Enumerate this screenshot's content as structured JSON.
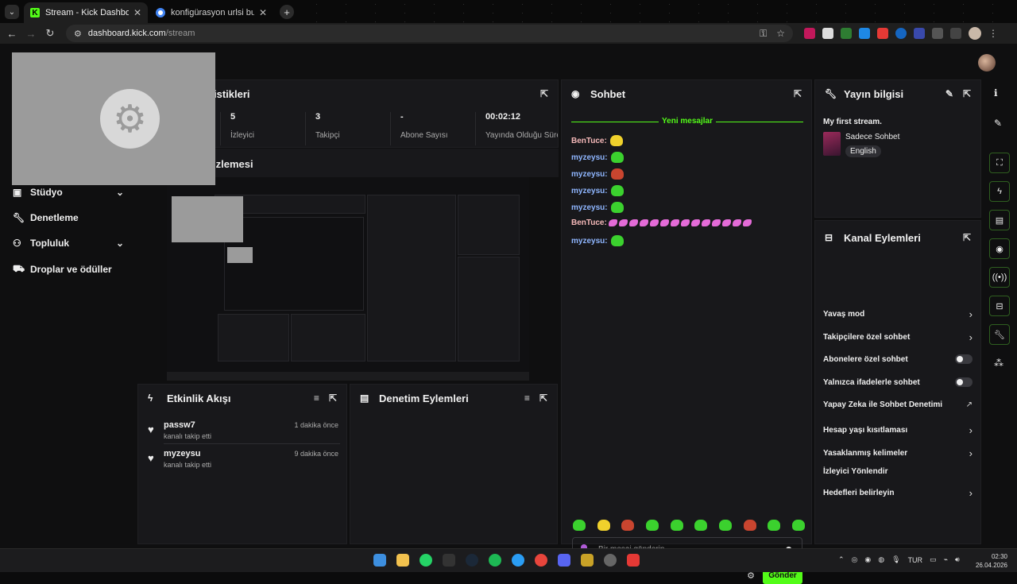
{
  "browser": {
    "tabs": [
      {
        "title": "Stream - Kick Dashboard",
        "active": true
      },
      {
        "title": "konfigürasyon urlsi bulunamadı",
        "active": false
      }
    ],
    "url_host": "dashboard.kick.com",
    "url_path": "/stream"
  },
  "sidebar": {
    "items": [
      {
        "label": "Stüdyo",
        "icon": "studio-icon",
        "chevron": true
      },
      {
        "label": "Denetleme",
        "icon": "wrench-icon",
        "chevron": false
      },
      {
        "label": "Topluluk",
        "icon": "community-icon",
        "chevron": true
      },
      {
        "label": "Droplar ve ödüller",
        "icon": "gift-icon",
        "chevron": false
      }
    ]
  },
  "stats": {
    "title_visible": "istikleri",
    "items": [
      {
        "value": "5",
        "label": "İzleyici"
      },
      {
        "value": "3",
        "label": "Takipçi"
      },
      {
        "value": "-",
        "label": "Abone Sayısı"
      },
      {
        "value": "00:02:12",
        "label": "Yayında Olduğu Süre"
      }
    ]
  },
  "preview": {
    "title_visible": "izlemesi"
  },
  "activity": {
    "title": "Etkinlik Akışı",
    "events": [
      {
        "user": "passw7",
        "action": "kanalı takip etti",
        "time": "1 dakika önce"
      },
      {
        "user": "myzeysu",
        "action": "kanalı takip etti",
        "time": "9 dakika önce"
      }
    ]
  },
  "moderation": {
    "title": "Denetim Eylemleri"
  },
  "chat": {
    "title": "Sohbet",
    "new_messages": "Yeni mesajlar",
    "messages": [
      {
        "user": "BenTuce:",
        "color": "#f4b8b8",
        "emotes": [
          "yellow"
        ]
      },
      {
        "user": "myzeysu:",
        "color": "#8fb6ff",
        "emotes": [
          "green"
        ]
      },
      {
        "user": "myzeysu:",
        "color": "#8fb6ff",
        "emotes": [
          "red"
        ]
      },
      {
        "user": "myzeysu:",
        "color": "#8fb6ff",
        "emotes": [
          "green"
        ]
      },
      {
        "user": "myzeysu:",
        "color": "#8fb6ff",
        "emotes": [
          "green"
        ]
      },
      {
        "user": "BenTuce:",
        "color": "#f4b8b8",
        "emotes": [
          "pink",
          "pink",
          "pink",
          "pink",
          "pink",
          "pink",
          "pink",
          "pink",
          "pink",
          "pink",
          "pink",
          "pink",
          "pink",
          "pink"
        ]
      },
      {
        "user": "myzeysu:",
        "color": "#8fb6ff",
        "emotes": [
          "green"
        ]
      }
    ],
    "emote_bar": [
      "green",
      "yellow",
      "red",
      "green",
      "green",
      "green",
      "green",
      "red",
      "green",
      "green"
    ],
    "input_placeholder": "Bir mesaj gönderin",
    "send_label": "Gönder"
  },
  "stream_info": {
    "title": "Yayın bilgisi",
    "stream_title": "My first stream.",
    "category": "Sadece Sohbet",
    "language": "English"
  },
  "channel_actions": {
    "title": "Kanal Eylemleri",
    "items": [
      {
        "label": "Yavaş mod",
        "control": "chevron"
      },
      {
        "label": "Takipçilere özel sohbet",
        "control": "chevron"
      },
      {
        "label": "Abonelere özel sohbet",
        "control": "toggle"
      },
      {
        "label": "Yalnızca ifadelerle sohbet",
        "control": "toggle"
      },
      {
        "label": "Yapay Zeka ile Sohbet Denetimi",
        "control": "external"
      },
      {
        "label": "Hesap yaşı kısıtlaması",
        "control": "chevron"
      },
      {
        "label": "Yasaklanmış kelimeler",
        "control": "chevron"
      },
      {
        "label": "İzleyici Yönlendir",
        "control": "none"
      },
      {
        "label": "Hedefleri belirleyin",
        "control": "chevron"
      }
    ]
  },
  "taskbar": {
    "lang": "TUR",
    "time": "02:30",
    "date": "26.04.2026"
  },
  "colors": {
    "accent": "#53fc18",
    "panel": "#18181b",
    "background": "#0f0f10"
  }
}
